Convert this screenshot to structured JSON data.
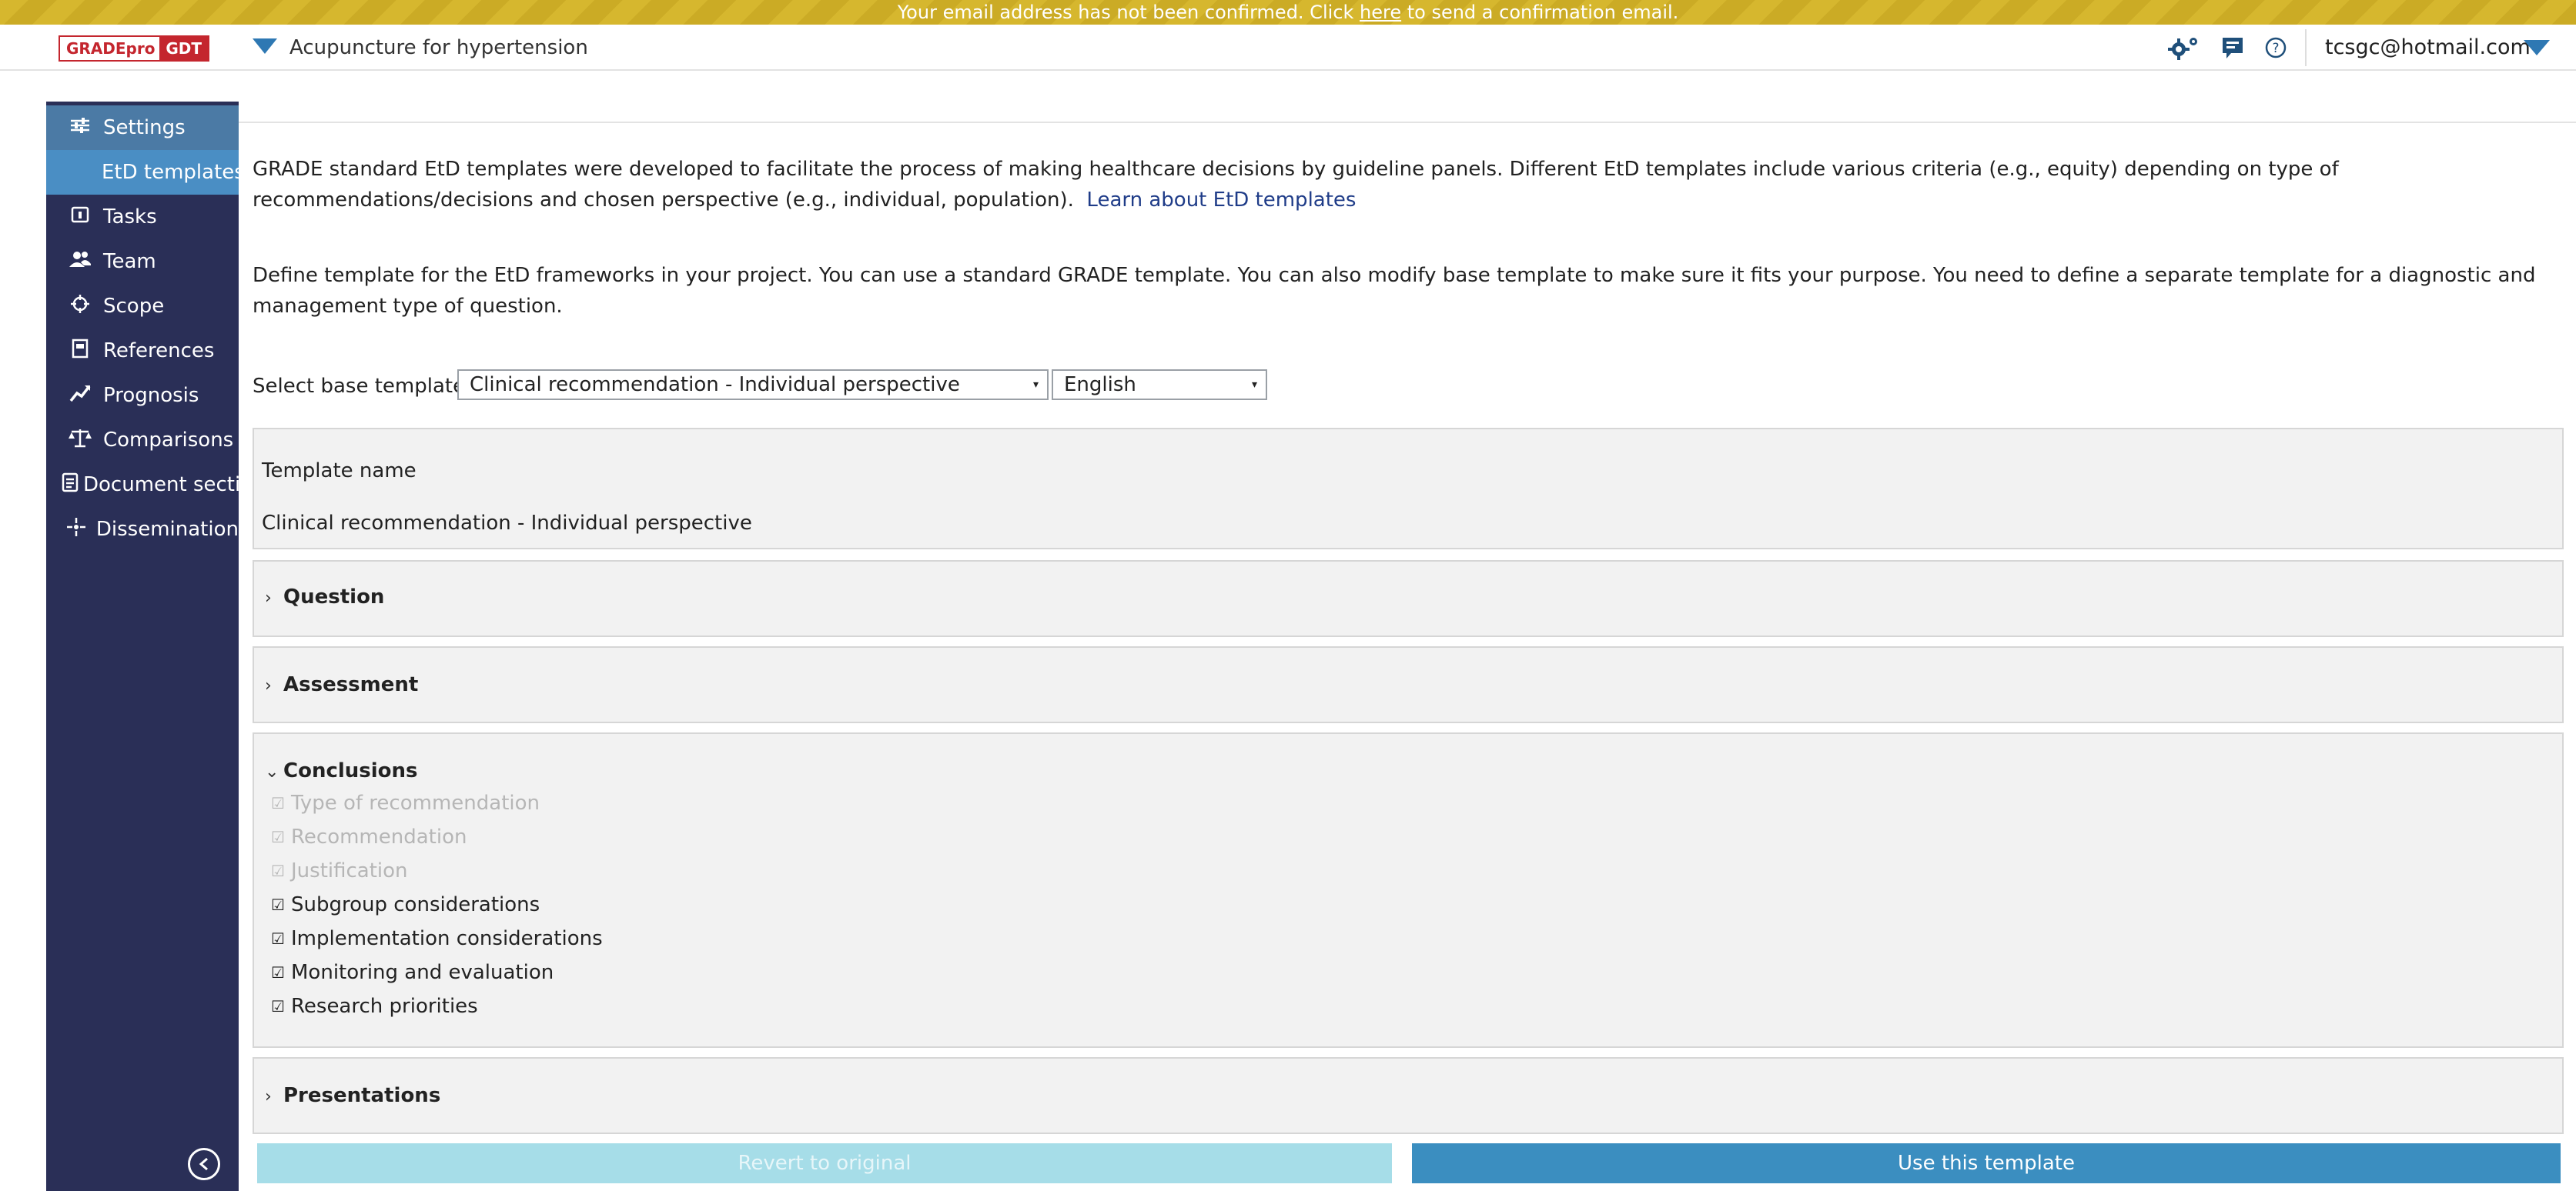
{
  "banner": {
    "text_before": "Your email address has not been confirmed. Click ",
    "link": "here",
    "text_after": " to send a confirmation email."
  },
  "header": {
    "logo_left": "GRADEpro",
    "logo_right": "GDT",
    "project_name": "Acupuncture for hypertension",
    "user_email": "tcsgc@hotmail.com",
    "icons": [
      "settings-gear-icon",
      "feedback-flag-icon",
      "help-icon",
      "chevron-down-icon"
    ]
  },
  "sidebar": {
    "items": [
      {
        "label": "Settings",
        "icon": "sliders-icon"
      },
      {
        "label": "EtD templates",
        "icon": ""
      },
      {
        "label": "Tasks",
        "icon": "tasks-icon"
      },
      {
        "label": "Team",
        "icon": "team-icon"
      },
      {
        "label": "Scope",
        "icon": "scope-icon"
      },
      {
        "label": "References",
        "icon": "references-icon"
      },
      {
        "label": "Prognosis",
        "icon": "prognosis-icon"
      },
      {
        "label": "Comparisons",
        "icon": "comparisons-icon"
      },
      {
        "label": "Document sections",
        "icon": "document-icon"
      },
      {
        "label": "Dissemination",
        "icon": "dissemination-icon"
      }
    ]
  },
  "main": {
    "intro_text": "GRADE standard EtD templates were developed to facilitate the process of making healthcare decisions by guideline panels. Different EtD templates include various criteria (e.g., equity) depending on type of recommendations/decisions and chosen perspective (e.g., individual, population).",
    "intro_link": "Learn about EtD templates",
    "define_text": "Define template for the EtD frameworks in your project. You can use a standard GRADE template. You can also modify base template to make sure it fits your purpose. You need to define a separate template for a diagnostic and management type of question.",
    "select_label": "Select base template",
    "base_template_value": "Clinical recommendation - Individual perspective",
    "language_value": "English",
    "template_name_label": "Template name",
    "template_name_value": "Clinical recommendation - Individual perspective",
    "sections": {
      "question": "Question",
      "assessment": "Assessment",
      "conclusions": "Conclusions",
      "presentations": "Presentations"
    },
    "conclusions_items": [
      {
        "label": "Type of recommendation",
        "checked": true,
        "disabled": true
      },
      {
        "label": "Recommendation",
        "checked": true,
        "disabled": true
      },
      {
        "label": "Justification",
        "checked": true,
        "disabled": true
      },
      {
        "label": "Subgroup considerations",
        "checked": true,
        "disabled": false
      },
      {
        "label": "Implementation considerations",
        "checked": true,
        "disabled": false
      },
      {
        "label": "Monitoring and evaluation",
        "checked": true,
        "disabled": false
      },
      {
        "label": "Research priorities",
        "checked": true,
        "disabled": false
      }
    ],
    "buttons": {
      "revert": "Revert to original",
      "use": "Use this template"
    }
  }
}
